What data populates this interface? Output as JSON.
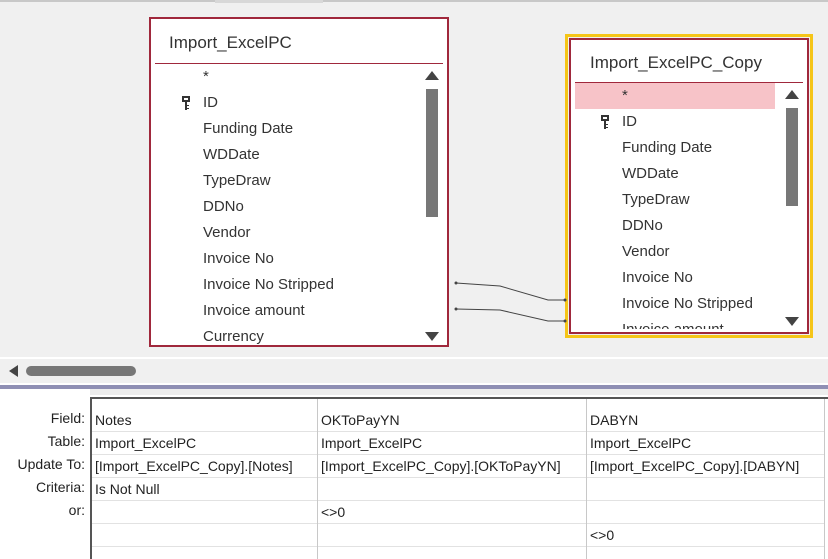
{
  "tables": [
    {
      "title": "Import_ExcelPC",
      "fields": [
        "*",
        "ID",
        "Funding Date",
        "WDDate",
        "TypeDraw",
        "DDNo",
        "Vendor",
        "Invoice No",
        "Invoice No Stripped",
        "Invoice amount",
        "Currency"
      ],
      "key_field_icon": "primary-key-icon"
    },
    {
      "title": "Import_ExcelPC_Copy",
      "fields": [
        "*",
        "ID",
        "Funding Date",
        "WDDate",
        "TypeDraw",
        "DDNo",
        "Vendor",
        "Invoice No",
        "Invoice No Stripped",
        "Invoice amount"
      ],
      "selected_field": "*",
      "key_field_icon": "primary-key-icon"
    }
  ],
  "grid": {
    "row_labels": [
      "Field:",
      "Table:",
      "Update To:",
      "Criteria:",
      "or:"
    ],
    "columns": [
      {
        "field": "Notes",
        "table": "Import_ExcelPC",
        "update_to": "[Import_ExcelPC_Copy].[Notes]",
        "criteria": "Is Not Null",
        "or": "",
        "or2": ""
      },
      {
        "field": "OKToPayYN",
        "table": "Import_ExcelPC",
        "update_to": "[Import_ExcelPC_Copy].[OKToPayYN]",
        "criteria": "",
        "or": "<>0",
        "or2": ""
      },
      {
        "field": "DABYN",
        "table": "Import_ExcelPC",
        "update_to": "[Import_ExcelPC_Copy].[DABYN]",
        "criteria": "",
        "or": "",
        "or2": "<>0"
      }
    ]
  },
  "colors": {
    "table_border": "#a0283c",
    "selected_table_outline": "#f5c518",
    "selected_field_bg": "#f7c3c8",
    "splitter": "#8f8fb4"
  }
}
